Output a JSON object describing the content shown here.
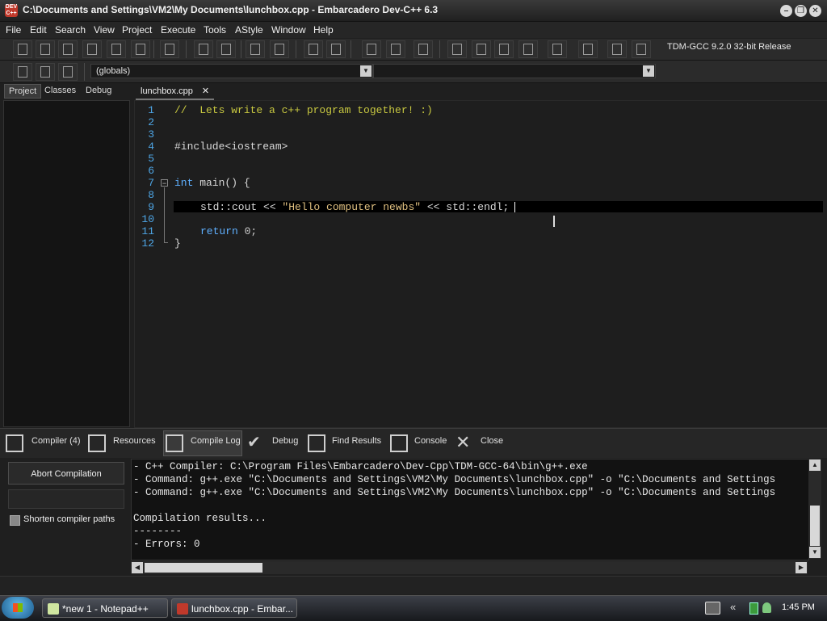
{
  "window": {
    "title": "C:\\Documents and Settings\\VM2\\My Documents\\lunchbox.cpp - Embarcadero Dev-C++ 6.3",
    "app_icon_text": "DEV C++"
  },
  "menu": [
    "File",
    "Edit",
    "Search",
    "View",
    "Project",
    "Execute",
    "Tools",
    "AStyle",
    "Window",
    "Help"
  ],
  "toolbar": {
    "compiler_select": "TDM-GCC 9.2.0 32-bit Release",
    "scope_select": "(globals)",
    "function_select": ""
  },
  "left_tabs": [
    "Project",
    "Classes",
    "Debug"
  ],
  "editor": {
    "file_tab": "lunchbox.cpp",
    "close_glyph": "✕",
    "line_numbers": [
      "1",
      "2",
      "3",
      "4",
      "5",
      "6",
      "7",
      "8",
      "9",
      "10",
      "11",
      "12"
    ],
    "lines": {
      "l1": "//  Lets write a c++ program together! :)",
      "l4": "#include<iostream>",
      "l7_kw": "int",
      "l7_rest": " main() {",
      "l9_a": "std::cout << ",
      "l9_str": "\"Hello computer newbs\"",
      "l9_b": " << std::endl;",
      "l11_kw": "return",
      "l11_num": " 0;",
      "l12": "}"
    }
  },
  "bottom_tabs": [
    "Compiler (4)",
    "Resources",
    "Compile Log",
    "Debug",
    "Find Results",
    "Console",
    "Close"
  ],
  "compile_panel": {
    "abort_label": "Abort Compilation",
    "shorten_label": "Shorten compiler paths",
    "shorten_checked": false
  },
  "log": [
    "- C++ Compiler: C:\\Program Files\\Embarcadero\\Dev-Cpp\\TDM-GCC-64\\bin\\g++.exe",
    "- Command: g++.exe \"C:\\Documents and Settings\\VM2\\My Documents\\lunchbox.cpp\" -o \"C:\\Documents and Settings",
    "- Command: g++.exe \"C:\\Documents and Settings\\VM2\\My Documents\\lunchbox.cpp\" -o \"C:\\Documents and Settings",
    "",
    "Compilation results...",
    "--------",
    "- Errors: 0"
  ],
  "taskbar": {
    "items": [
      "*new 1 - Notepad++",
      "lunchbox.cpp - Embar..."
    ],
    "clock": "1:45 PM",
    "tray_chevron": "«"
  },
  "colors": {
    "line_numbers": "#4ea6e6",
    "keyword": "#5fb0ff",
    "comment": "#c8c840"
  }
}
